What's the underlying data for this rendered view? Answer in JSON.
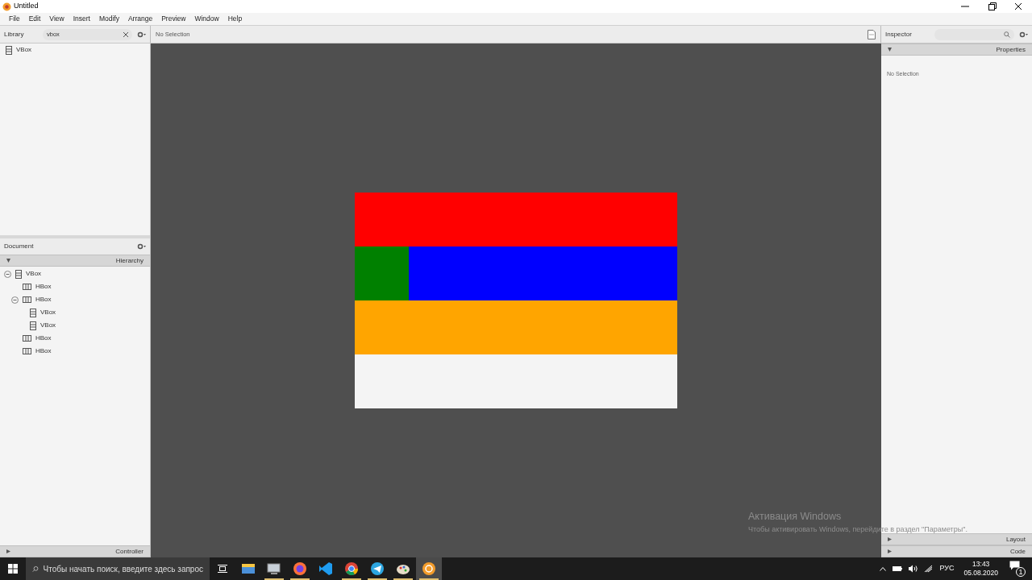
{
  "window": {
    "title": "Untitled"
  },
  "menu": [
    "File",
    "Edit",
    "View",
    "Insert",
    "Modify",
    "Arrange",
    "Preview",
    "Window",
    "Help"
  ],
  "library": {
    "title": "Library",
    "search_value": "vbox",
    "items": [
      {
        "label": "VBox",
        "kind": "vbox"
      }
    ]
  },
  "content_toolbar": {
    "selection": "No Selection"
  },
  "canvas": {
    "rows": [
      {
        "cells": [
          {
            "kind": "fill",
            "color": "#ff0000"
          }
        ]
      },
      {
        "cells": [
          {
            "kind": "square",
            "color": "#008000"
          },
          {
            "kind": "fill",
            "color": "#0000ff"
          }
        ]
      },
      {
        "cells": [
          {
            "kind": "fill",
            "color": "#ffa500"
          }
        ]
      },
      {
        "cells": [
          {
            "kind": "fill",
            "color": "#f4f4f4"
          }
        ]
      }
    ]
  },
  "document": {
    "title": "Document",
    "section": "Hierarchy",
    "tree": [
      {
        "label": "VBox",
        "kind": "vbox",
        "expanded": true,
        "children": [
          {
            "label": "HBox",
            "kind": "hbox"
          },
          {
            "label": "HBox",
            "kind": "hbox",
            "expanded": true,
            "children": [
              {
                "label": "VBox",
                "kind": "vbox"
              },
              {
                "label": "VBox",
                "kind": "vbox"
              }
            ]
          },
          {
            "label": "HBox",
            "kind": "hbox"
          },
          {
            "label": "HBox",
            "kind": "hbox"
          }
        ]
      }
    ],
    "footer": "Controller"
  },
  "inspector": {
    "title": "Inspector",
    "section": "Properties",
    "message": "No Selection",
    "footers": [
      "Layout",
      "Code"
    ]
  },
  "activation": {
    "title": "Активация Windows",
    "message": "Чтобы активировать Windows, перейдите в раздел \"Параметры\"."
  },
  "taskbar": {
    "search_placeholder": "Чтобы начать поиск, введите здесь запрос",
    "apps": [
      {
        "kind": "folder",
        "running": false,
        "selected": false
      },
      {
        "kind": "monitor",
        "running": true,
        "selected": false
      },
      {
        "kind": "firefox",
        "running": true,
        "selected": false
      },
      {
        "kind": "code",
        "running": false,
        "selected": false
      },
      {
        "kind": "chrome",
        "running": true,
        "selected": false
      },
      {
        "kind": "telegram",
        "running": true,
        "selected": false
      },
      {
        "kind": "palette",
        "running": true,
        "selected": false
      },
      {
        "kind": "builder",
        "running": true,
        "selected": true
      }
    ],
    "language": "РУС",
    "time": "13:43",
    "date": "05.08.2020",
    "notifications": "1"
  }
}
